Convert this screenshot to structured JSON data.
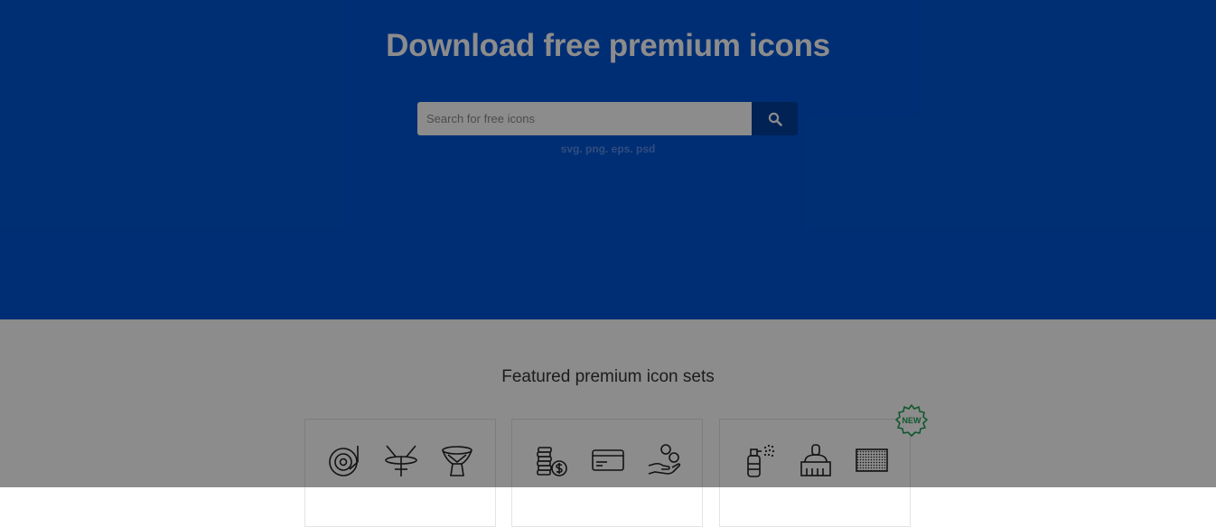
{
  "hero": {
    "title": "Download free premium icons",
    "search_placeholder": "Search for free icons",
    "formats": "svg. png. eps. psd",
    "search_icon": "search-icon"
  },
  "featured": {
    "title": "Featured premium icon sets",
    "new_badge": "NEW",
    "sets": [
      {
        "icons": [
          "vinyl-record-icon",
          "cymbal-icon",
          "djembe-drum-icon"
        ]
      },
      {
        "icons": [
          "coin-stack-dollar-icon",
          "credit-card-icon",
          "hand-coins-icon"
        ]
      },
      {
        "icons": [
          "spray-bottle-icon",
          "cleaning-brush-icon",
          "sponge-icon"
        ],
        "badge": "NEW"
      }
    ]
  },
  "colors": {
    "hero_bg": "#0055d4",
    "search_button": "#003f9c",
    "badge": "#1e9e54"
  }
}
